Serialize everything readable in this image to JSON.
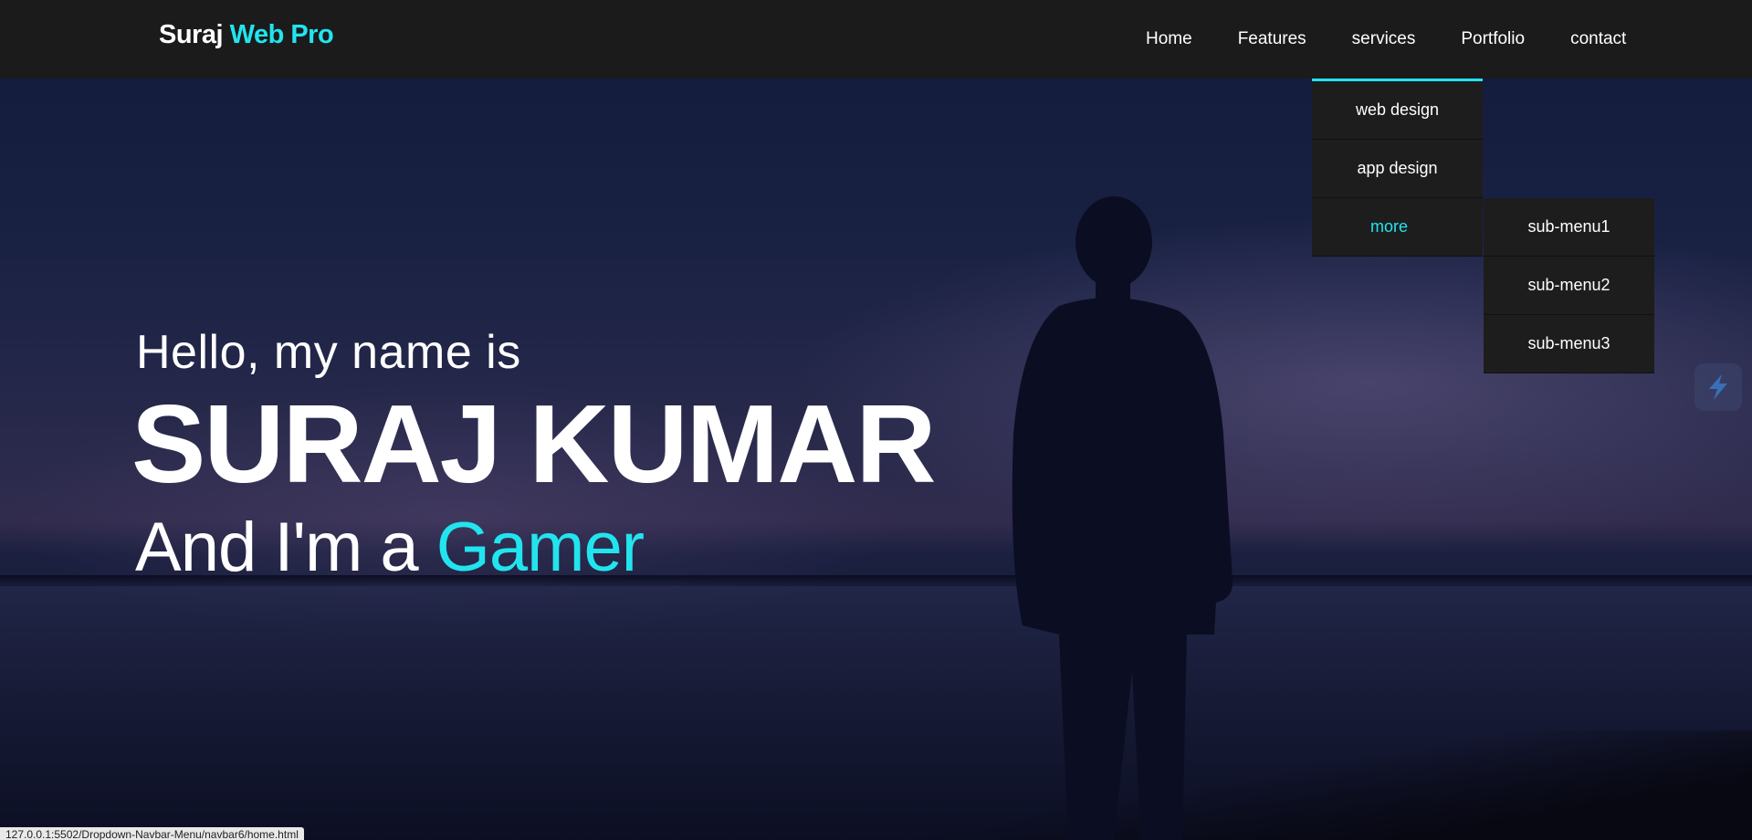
{
  "brand": {
    "part1": "Suraj ",
    "part2": "Web Pro"
  },
  "nav": {
    "items": [
      {
        "label": "Home"
      },
      {
        "label": "Features"
      },
      {
        "label": "services"
      },
      {
        "label": "Portfolio"
      },
      {
        "label": "contact"
      }
    ]
  },
  "dropdown": {
    "items": [
      {
        "label": "web design"
      },
      {
        "label": "app design"
      },
      {
        "label": "more"
      }
    ],
    "submenu": [
      {
        "label": "sub-menu1"
      },
      {
        "label": "sub-menu2"
      },
      {
        "label": "sub-menu3"
      }
    ]
  },
  "hero": {
    "greeting": "Hello, my name is",
    "name": "SURAJ KUMAR",
    "role_prefix": "And I'm a ",
    "role_word": "Gamer"
  },
  "status_bar": {
    "url": "127.0.0.1:5502/Dropdown-Navbar-Menu/navbar6/home.html"
  },
  "colors": {
    "accent": "#22e4ee",
    "navbar_bg": "#1b1b1b",
    "dropdown_bg": "#1d1d1d"
  }
}
